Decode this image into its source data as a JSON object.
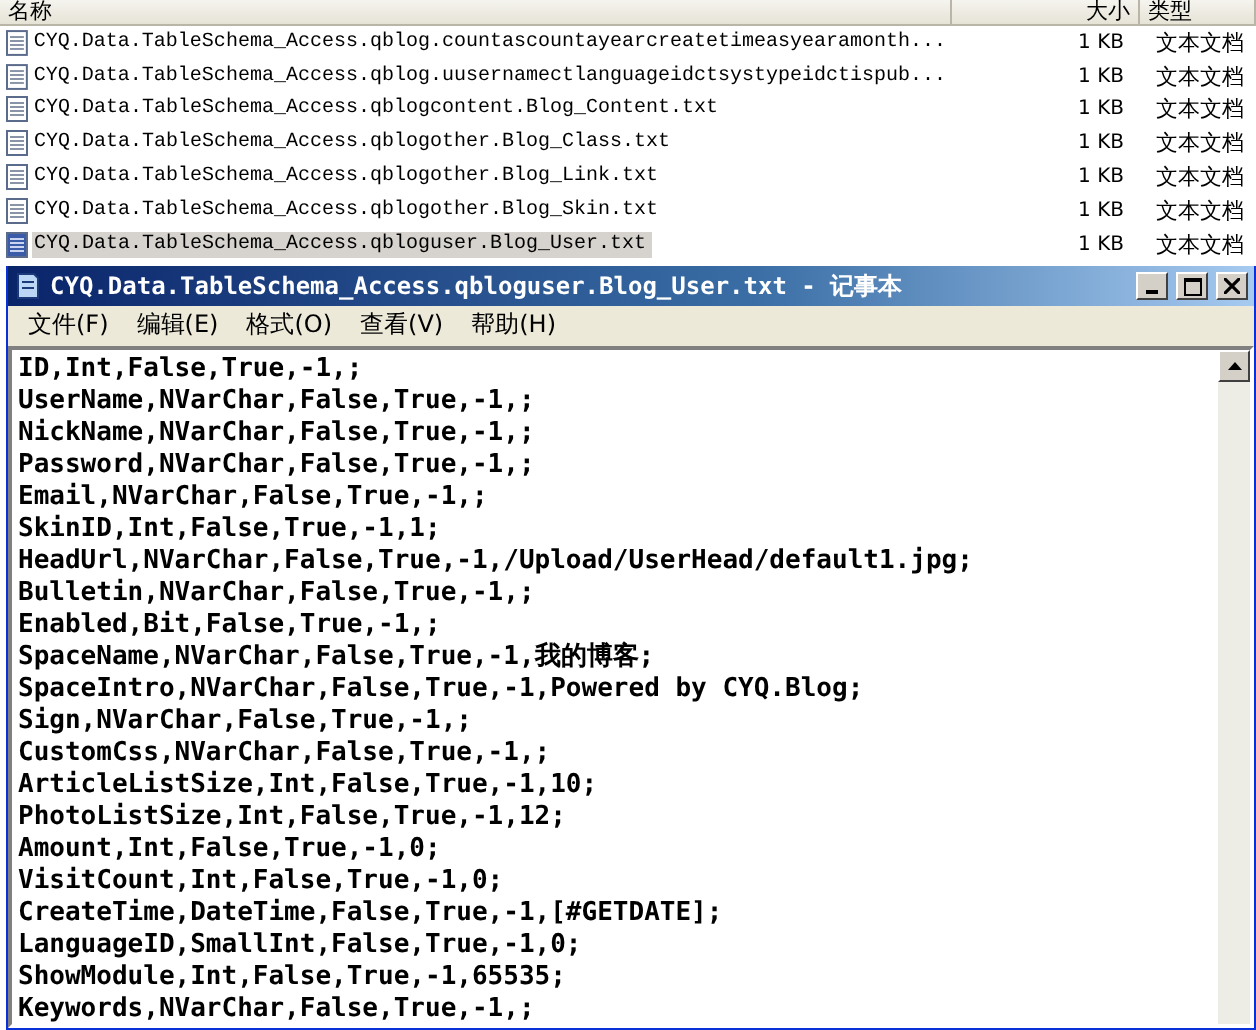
{
  "explorer": {
    "columns": [
      "名称",
      "大小",
      "类型"
    ],
    "rows": [
      {
        "name": "CYQ.Data.TableSchema_Access.qblog.countascountayearcreatetimeasyearamonth...",
        "size": "1 KB",
        "type": "文本文档",
        "selected": false
      },
      {
        "name": "CYQ.Data.TableSchema_Access.qblog.uusernamectlanguageidctsystypeidctispub...",
        "size": "1 KB",
        "type": "文本文档",
        "selected": false
      },
      {
        "name": "CYQ.Data.TableSchema_Access.qblogcontent.Blog_Content.txt",
        "size": "1 KB",
        "type": "文本文档",
        "selected": false
      },
      {
        "name": "CYQ.Data.TableSchema_Access.qblogother.Blog_Class.txt",
        "size": "1 KB",
        "type": "文本文档",
        "selected": false
      },
      {
        "name": "CYQ.Data.TableSchema_Access.qblogother.Blog_Link.txt",
        "size": "1 KB",
        "type": "文本文档",
        "selected": false
      },
      {
        "name": "CYQ.Data.TableSchema_Access.qblogother.Blog_Skin.txt",
        "size": "1 KB",
        "type": "文本文档",
        "selected": false
      },
      {
        "name": "CYQ.Data.TableSchema_Access.qbloguser.Blog_User.txt",
        "size": "1 KB",
        "type": "文本文档",
        "selected": true
      }
    ]
  },
  "notepad": {
    "title": "CYQ.Data.TableSchema_Access.qbloguser.Blog_User.txt - 记事本",
    "menu": [
      "文件(F)",
      "编辑(E)",
      "格式(O)",
      "查看(V)",
      "帮助(H)"
    ],
    "lines": [
      "ID,Int,False,True,-1,;",
      "UserName,NVarChar,False,True,-1,;",
      "NickName,NVarChar,False,True,-1,;",
      "Password,NVarChar,False,True,-1,;",
      "Email,NVarChar,False,True,-1,;",
      "SkinID,Int,False,True,-1,1;",
      "HeadUrl,NVarChar,False,True,-1,/Upload/UserHead/default1.jpg;",
      "Bulletin,NVarChar,False,True,-1,;",
      "Enabled,Bit,False,True,-1,;",
      "SpaceName,NVarChar,False,True,-1,我的博客;",
      "SpaceIntro,NVarChar,False,True,-1,Powered by CYQ.Blog;",
      "Sign,NVarChar,False,True,-1,;",
      "CustomCss,NVarChar,False,True,-1,;",
      "ArticleListSize,Int,False,True,-1,10;",
      "PhotoListSize,Int,False,True,-1,12;",
      "Amount,Int,False,True,-1,0;",
      "VisitCount,Int,False,True,-1,0;",
      "CreateTime,DateTime,False,True,-1,[#GETDATE];",
      "LanguageID,SmallInt,False,True,-1,0;",
      "ShowModule,Int,False,True,-1,65535;",
      "Keywords,NVarChar,False,True,-1,;"
    ]
  }
}
